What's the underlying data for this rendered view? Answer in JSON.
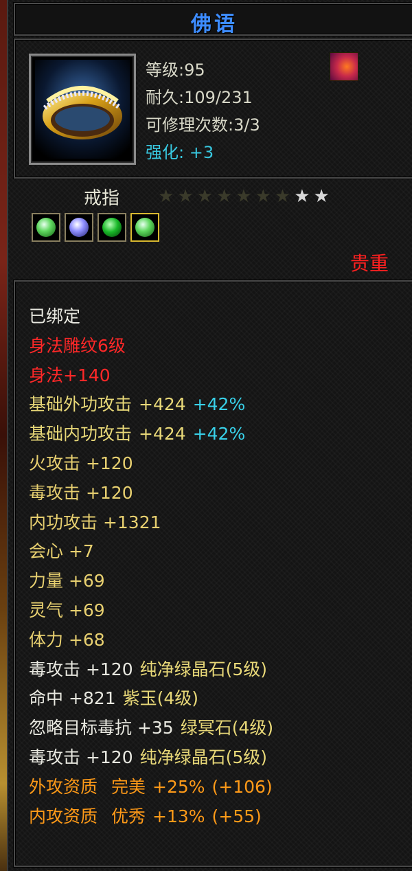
{
  "item": {
    "name": "佛语",
    "icon": "gold-ring-icon",
    "skill_icon": "fire-swirl-icon",
    "level_text": "等级:95",
    "durability_text": "耐久:109/231",
    "repair_text": "可修理次数:3/3",
    "enhance_label": "强化:",
    "enhance_value": "+3",
    "type": "戒指",
    "stars": {
      "filled": 7,
      "total": 9
    },
    "gems": [
      "green-crystal-icon",
      "purple-crystal-icon",
      "green-emerald-icon",
      "green-crystal-icon"
    ],
    "rarity": "贵重"
  },
  "stats": {
    "bound": "已绑定",
    "engrave": "身法雕纹6级",
    "agility": "身法+140",
    "ext_atk_label": "基础外功攻击",
    "ext_atk_val": "+424",
    "ext_atk_pct": "+42%",
    "int_atk_label": "基础内功攻击",
    "int_atk_val": "+424",
    "int_atk_pct": "+42%",
    "fire": "火攻击 +120",
    "poison": "毒攻击 +120",
    "inner": "内功攻击 +1321",
    "crit": "会心 +7",
    "str": "力量 +69",
    "spirit": "灵气 +69",
    "vit": "体力 +68",
    "gem1_stat": "毒攻击 +120",
    "gem1_name": "纯净绿晶石(5级)",
    "gem2_stat": "命中 +821",
    "gem2_name": "紫玉(4级)",
    "gem3_stat": "忽略目标毒抗 +35",
    "gem3_name": "绿冥石(4级)",
    "gem4_stat": "毒攻击 +120",
    "gem4_name": "纯净绿晶石(5级)",
    "q1": "外攻资质",
    "q1_grade": "完美",
    "q1_val": "+25%",
    "q1_bonus": "(+106)",
    "q2": "内攻资质",
    "q2_grade": "优秀",
    "q2_val": "+13%",
    "q2_bonus": "(+55)"
  },
  "colors": {
    "title": "#3d8cff",
    "red": "#ff2828",
    "cyan": "#38d0e8",
    "orange": "#ff9a18",
    "yellow": "#e8d878"
  }
}
